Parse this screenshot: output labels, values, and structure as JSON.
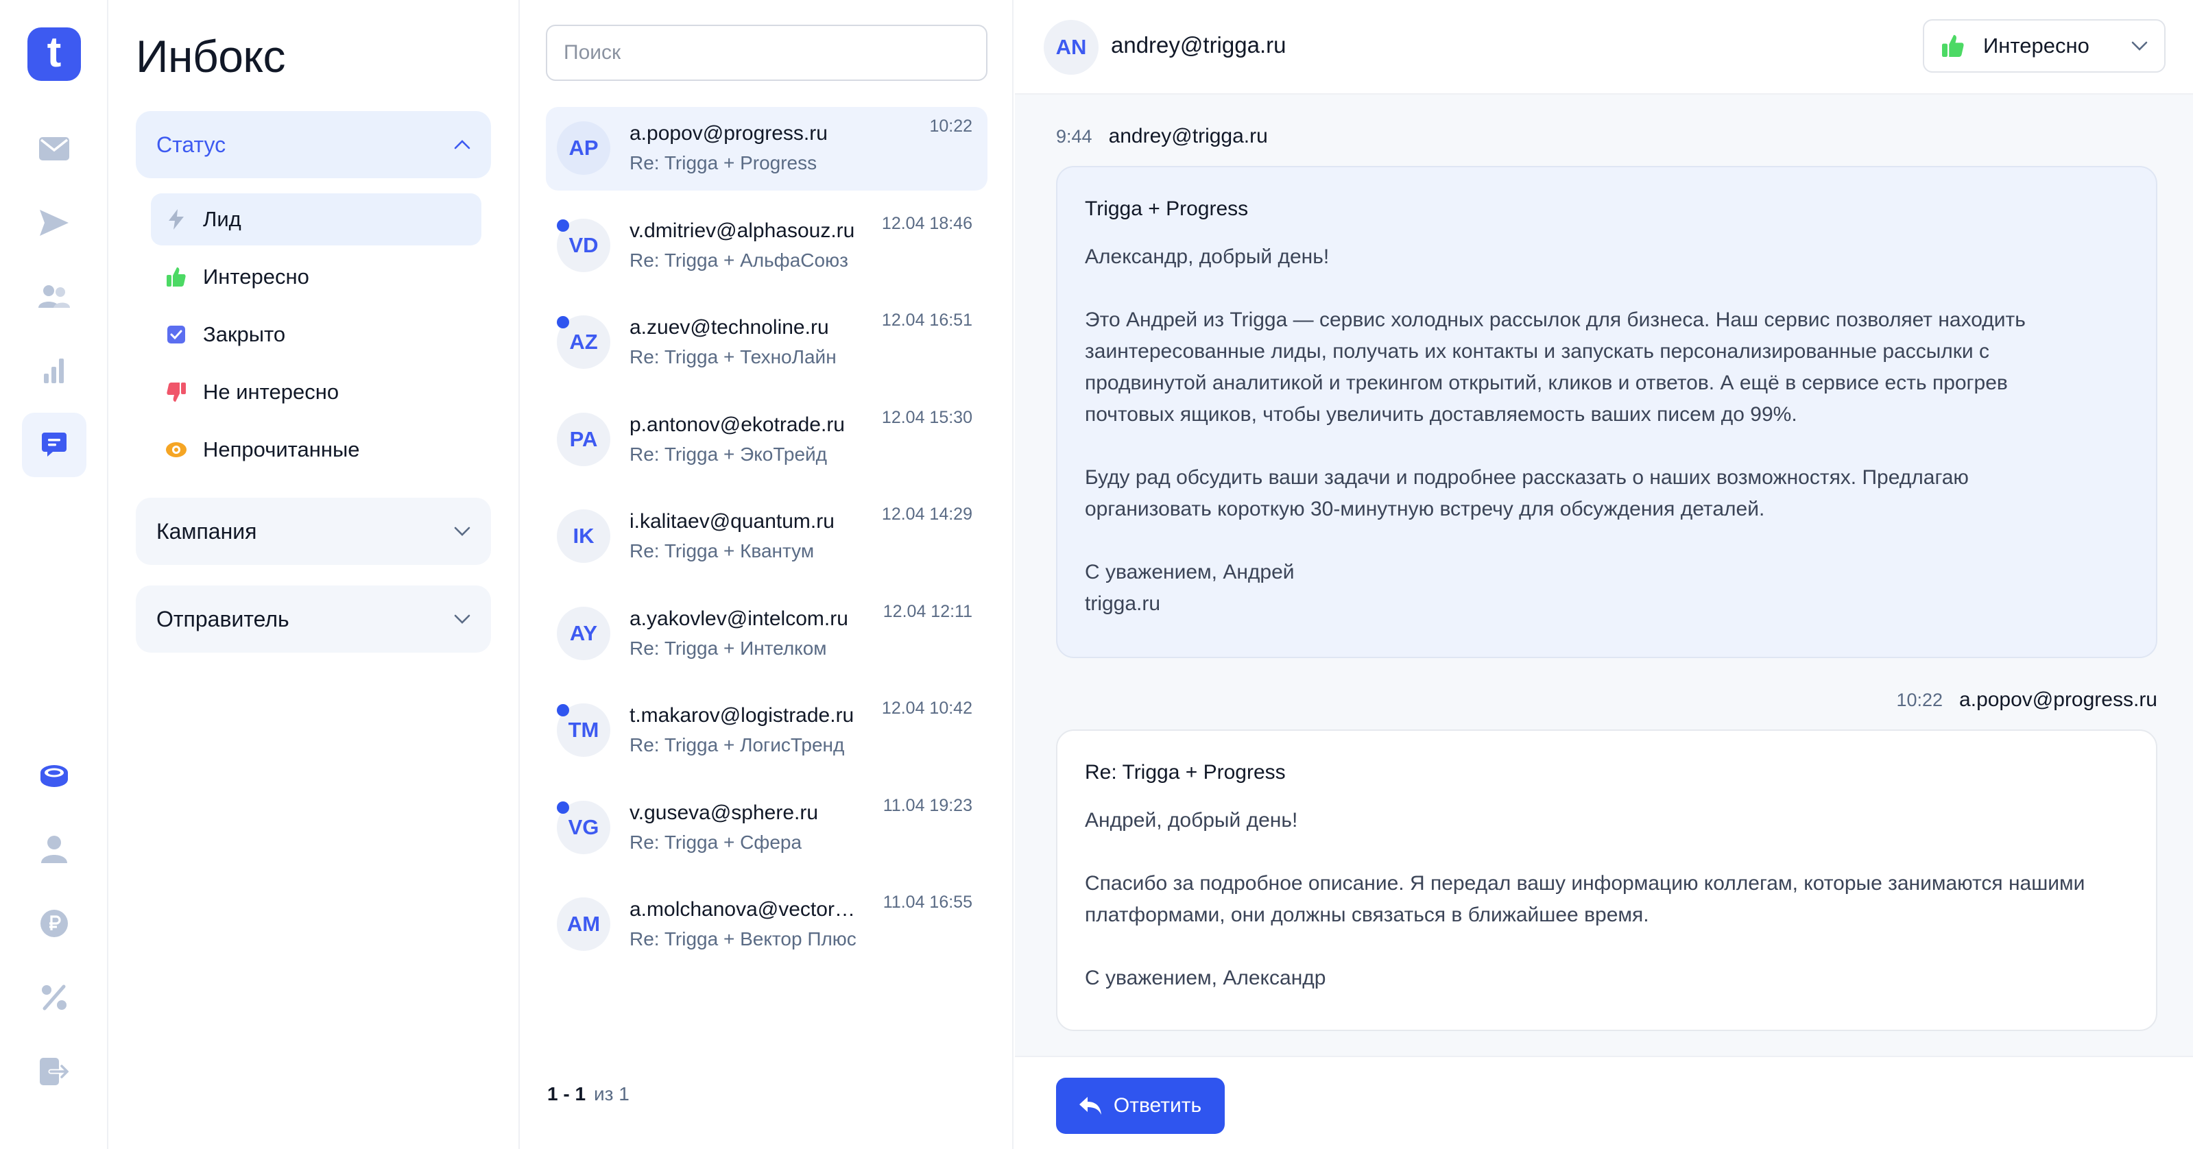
{
  "rail": {
    "logo_letter": "t",
    "icons": [
      "mail-icon",
      "send-icon",
      "users-icon",
      "chart-icon",
      "chat-icon",
      "coins-icon",
      "profile-icon",
      "ruble-icon",
      "percent-icon",
      "logout-icon"
    ],
    "active": "chat-icon"
  },
  "filters": {
    "title": "Инбокс",
    "status": {
      "label": "Статус",
      "items": [
        {
          "label": "Лид",
          "icon": "bolt-icon",
          "color": "#a9b6cc"
        },
        {
          "label": "Интересно",
          "icon": "thumbs-up-icon",
          "color": "#4cd964"
        },
        {
          "label": "Закрыто",
          "icon": "checkbox-icon",
          "color": "#5b6ef0"
        },
        {
          "label": "Не интересно",
          "icon": "thumbs-down-icon",
          "color": "#f0566a"
        },
        {
          "label": "Непрочитанные",
          "icon": "eye-icon",
          "color": "#f5a524"
        }
      ]
    },
    "campaign_label": "Кампания",
    "sender_label": "Отправитель"
  },
  "list": {
    "search_placeholder": "Поиск",
    "rows": [
      {
        "initials": "AP",
        "email": "a.popov@progress.ru",
        "subject": "Re: Trigga + Progress",
        "time": "10:22",
        "unread": false
      },
      {
        "initials": "VD",
        "email": "v.dmitriev@alphasouz.ru",
        "subject": "Re: Trigga + АльфаСоюз",
        "time": "12.04 18:46",
        "unread": true
      },
      {
        "initials": "AZ",
        "email": "a.zuev@technoline.ru",
        "subject": "Re: Trigga + ТехноЛайн",
        "time": "12.04 16:51",
        "unread": true
      },
      {
        "initials": "PA",
        "email": "p.antonov@ekotrade.ru",
        "subject": "Re: Trigga + ЭкоТрейд",
        "time": "12.04 15:30",
        "unread": false
      },
      {
        "initials": "IK",
        "email": "i.kalitaev@quantum.ru",
        "subject": "Re: Trigga + Квантум",
        "time": "12.04 14:29",
        "unread": false
      },
      {
        "initials": "AY",
        "email": "a.yakovlev@intelcom.ru",
        "subject": "Re: Trigga + Интелком",
        "time": "12.04 12:11",
        "unread": false
      },
      {
        "initials": "TM",
        "email": "t.makarov@logistrade.ru",
        "subject": "Re: Trigga + ЛогисТренд",
        "time": "12.04 10:42",
        "unread": true
      },
      {
        "initials": "VG",
        "email": "v.guseva@sphere.ru",
        "subject": "Re: Trigga + Сфера",
        "time": "11.04 19:23",
        "unread": true
      },
      {
        "initials": "AM",
        "email": "a.molchanova@vector-plus.ru",
        "subject": "Re: Trigga + Вектор Плюс",
        "time": "11.04 16:55",
        "unread": false
      }
    ],
    "pager": {
      "range": "1 - 1",
      "total": "из 1"
    }
  },
  "conversation": {
    "header": {
      "initials": "AN",
      "email": "andrey@trigga.ru"
    },
    "status_select": {
      "value": "Интересно",
      "icon": "thumbs-up-icon"
    },
    "messages": [
      {
        "time": "9:44",
        "from": "andrey@trigga.ru",
        "subject": "Trigga + Progress",
        "lines": [
          "Александр, добрый день!",
          "",
          "Это Андрей из Trigga — сервис холодных рассылок для бизнеса. Наш сервис позволяет находить",
          "заинтересованные лиды, получать их контакты и запускать персонализированные рассылки с",
          "продвинутой аналитикой и трекингом открытий, кликов и ответов. А ещё в сервисе есть прогрев",
          "почтовых ящиков, чтобы увеличить доставляемость ваших писем до 99%.",
          "",
          "Буду рад обсудить ваши задачи и подробнее рассказать о наших возможностях. Предлагаю",
          "организовать короткую 30-минутную встречу для обсуждения деталей.",
          "",
          "С уважением, Андрей",
          "trigga.ru"
        ]
      },
      {
        "time": "10:22",
        "from": "a.popov@progress.ru",
        "subject": "Re: Trigga + Progress",
        "lines": [
          "Андрей, добрый день!",
          "",
          "Спасибо за подробное описание. Я передал вашу информацию коллегам, которые занимаются нашими",
          "платформами, они должны связаться в ближайшее время.",
          "",
          "С уважением, Александр"
        ]
      }
    ],
    "reply_label": "Ответить"
  },
  "colors": {
    "accent": "#3d5af1",
    "unread_dot": "#2f55ef",
    "interesting": "#4cd964"
  }
}
